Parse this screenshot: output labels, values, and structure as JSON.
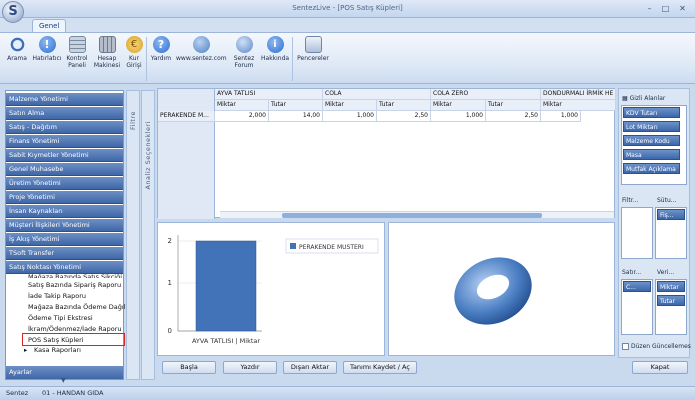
{
  "window": {
    "title": "SentezLive - [POS Satış Küpleri]"
  },
  "ribbon": {
    "tab": "Genel",
    "buttons": [
      {
        "label": "Arama",
        "icon": "search-icon",
        "color": "#3d6fb6"
      },
      {
        "label": "Hatırlatıcı",
        "icon": "info-icon",
        "color": "#2e6ed1"
      },
      {
        "label": "Kontrol Paneli",
        "icon": "control-panel-icon",
        "color": "#c9d3df"
      },
      {
        "label": "Hesap Makinesi",
        "icon": "calculator-icon",
        "color": "#b4bdc9"
      },
      {
        "label": "Kur Girişi",
        "icon": "currency-icon",
        "color": "#d8a020"
      },
      {
        "label": "Yardım",
        "icon": "help-icon",
        "color": "#2e6ed1"
      },
      {
        "label": "www.sentez.com",
        "icon": "web-icon",
        "color": "#4d7fc0"
      },
      {
        "label": "Sentez Forum",
        "icon": "forum-icon",
        "color": "#5a88c8"
      },
      {
        "label": "Hakkında",
        "icon": "about-icon",
        "color": "#2e6ed1"
      },
      {
        "label": "Pencereler",
        "icon": "windows-icon",
        "color": "#aebfd8"
      }
    ]
  },
  "nav": {
    "modules": [
      "Malzeme Yönetimi",
      "Satın Alma",
      "Satış - Dağıtım",
      "Finans Yönetimi",
      "Sabit Kıymetler Yönetimi",
      "Genel Muhasebe",
      "Üretim Yönetimi",
      "Proje Yönetimi",
      "İnsan Kaynakları",
      "Müşteri İlişkileri Yönetimi",
      "İş Akış Yönetimi",
      "TSoft Transfer",
      "Satış Noktası Yönetimi"
    ],
    "sub_items": [
      "Mağaza Bazında Satış Şikçiği",
      "Satış Bazında Sipariş Raporu",
      "İade Takip Raporu",
      "Mağaza Bazında Ödeme Dağıl",
      "Ödeme Tipi Ekstresi",
      "İkram/Ödenmez/İade Raporu",
      "POS Satış Küpleri",
      "Kasa Raporları"
    ],
    "footer": "Ayarlar"
  },
  "strips": {
    "filter": "Filtre",
    "analysis": "Analiz Seçenekleri"
  },
  "grid": {
    "columns": [
      "AYVA TATLISI",
      "COLA",
      "COLA ZERO",
      "DONDURMALI İRMİK HE"
    ],
    "subheaders": [
      "Miktar",
      "Tutar"
    ],
    "row_label": "PERAKENDE M...",
    "values": [
      "2,000",
      "14,00",
      "1,000",
      "2,50",
      "1,000",
      "2,50",
      "1,000"
    ]
  },
  "fields": {
    "title": "Gizli Alanlar",
    "hidden": [
      "KDV Tutarı",
      "Lot Miktarı",
      "Malzeme Kodu",
      "Masa",
      "Mutfak Açıklama"
    ],
    "filter_label": "Filtr...",
    "column_label": "Sütu...",
    "column_item": "Fiş...",
    "row_label": "Satır...",
    "row_item": "C...",
    "value_label": "Veri...",
    "value_items": [
      "Miktar",
      "Tutar"
    ],
    "checkbox_label": "Düzen Güncellemes"
  },
  "chart_data": [
    {
      "type": "bar",
      "categories": [
        "AYVA TATLISI | Miktar"
      ],
      "series": [
        {
          "name": "PERAKENDE MUSTERI",
          "values": [
            2
          ]
        }
      ],
      "ylim": [
        0,
        2
      ],
      "yticks": [
        "0",
        "1",
        "2"
      ],
      "color": "#4272b8"
    }
  ],
  "buttons": {
    "basla": "Başla",
    "yazdir": "Yazdır",
    "disari": "Dışarı Aktar",
    "tanimi": "Tanımı Kaydet / Aç",
    "kapat": "Kapat"
  },
  "status": {
    "company": "Sentez",
    "user": "01 - HANDAN GIDA"
  }
}
